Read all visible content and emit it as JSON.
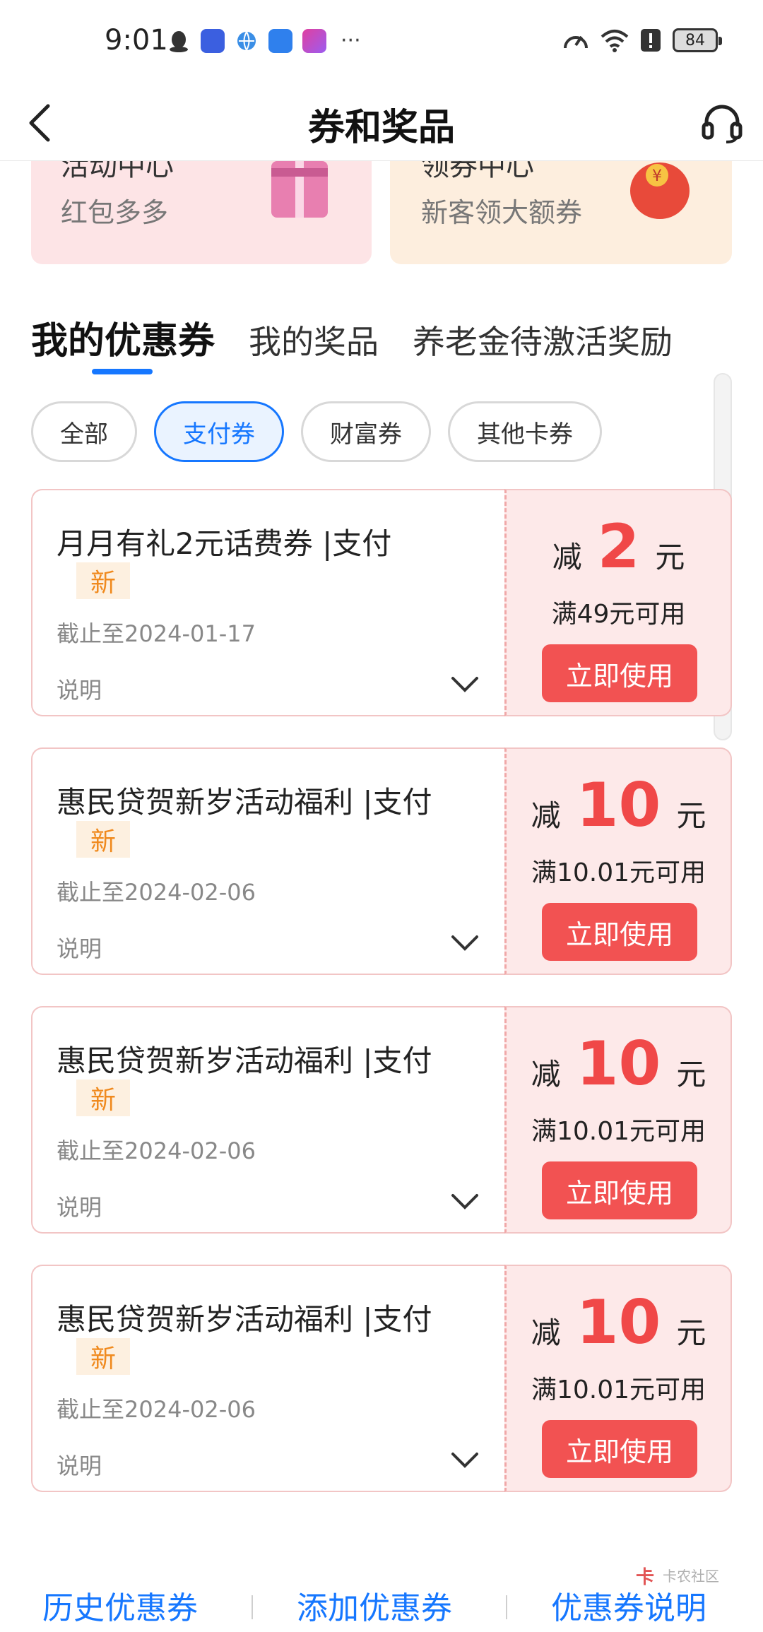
{
  "status_bar": {
    "time": "9:01",
    "battery": "84",
    "more": "···",
    "left_icons": [
      "qq-icon",
      "news-app-icon",
      "browser-icon",
      "weather-app-icon",
      "app-icon"
    ],
    "right_icons": [
      "speed-icon",
      "wifi-icon",
      "alert-icon",
      "battery-icon"
    ]
  },
  "header": {
    "title": "券和奖品"
  },
  "promos": [
    {
      "title": "活动中心",
      "subtitle": "红包多多",
      "icon": "gift-icon"
    },
    {
      "title": "领券中心",
      "subtitle": "新客领大额券",
      "icon": "red-envelope-icon"
    }
  ],
  "tabs": [
    {
      "label": "我的优惠券",
      "active": true
    },
    {
      "label": "我的奖品",
      "active": false
    },
    {
      "label": "养老金待激活奖励",
      "active": false
    }
  ],
  "filters": [
    {
      "label": "全部",
      "active": false
    },
    {
      "label": "支付券",
      "active": true
    },
    {
      "label": "财富券",
      "active": false
    },
    {
      "label": "其他卡券",
      "active": false
    }
  ],
  "coupons": [
    {
      "name": "月月有礼2元话费券 |支付",
      "badge": "新",
      "expire": "截止至2024-01-17",
      "desc": "说明",
      "prefix": "减",
      "amount": "2",
      "unit": "元",
      "threshold": "满49元可用",
      "button": "立即使用"
    },
    {
      "name": "惠民贷贺新岁活动福利 |支付",
      "badge": "新",
      "expire": "截止至2024-02-06",
      "desc": "说明",
      "prefix": "减",
      "amount": "10",
      "unit": "元",
      "threshold": "满10.01元可用",
      "button": "立即使用"
    },
    {
      "name": "惠民贷贺新岁活动福利 |支付",
      "badge": "新",
      "expire": "截止至2024-02-06",
      "desc": "说明",
      "prefix": "减",
      "amount": "10",
      "unit": "元",
      "threshold": "满10.01元可用",
      "button": "立即使用"
    },
    {
      "name": "惠民贷贺新岁活动福利 |支付",
      "badge": "新",
      "expire": "截止至2024-02-06",
      "desc": "说明",
      "prefix": "减",
      "amount": "10",
      "unit": "元",
      "threshold": "满10.01元可用",
      "button": "立即使用"
    }
  ],
  "bottom": {
    "history": "历史优惠券",
    "add": "添加优惠券",
    "explain": "优惠券说明"
  },
  "watermark": "卡农社区",
  "colors": {
    "accent": "#1677ff",
    "coupon_red": "#f04848",
    "button_red": "#f25252",
    "new_badge": "#f08a1e"
  }
}
